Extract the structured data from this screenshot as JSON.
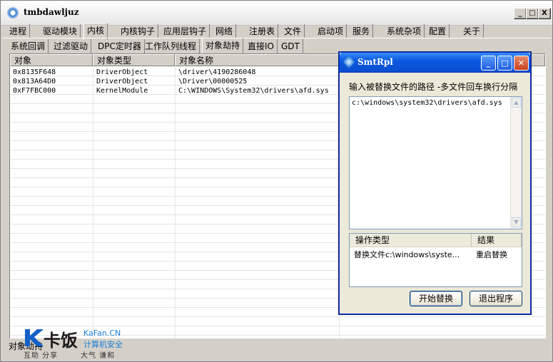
{
  "window": {
    "title": "tmbdawljuz",
    "min": "_",
    "max": "□",
    "close": "X"
  },
  "tabs_main": [
    {
      "label": "进程"
    },
    {
      "label": "驱动模块"
    },
    {
      "label": "内核"
    },
    {
      "label": "内核钩子"
    },
    {
      "label": "应用层钩子"
    },
    {
      "label": "网络"
    },
    {
      "label": "注册表"
    },
    {
      "label": "文件"
    },
    {
      "label": "启动项"
    },
    {
      "label": "服务"
    },
    {
      "label": "系统杂项"
    },
    {
      "label": "配置"
    },
    {
      "label": "关于"
    }
  ],
  "active_main_tab": "内核",
  "tabs_sub": [
    {
      "label": "系统回调"
    },
    {
      "label": "过滤驱动"
    },
    {
      "label": "DPC定时器"
    },
    {
      "label": "工作队列线程"
    },
    {
      "label": "对象劫持"
    },
    {
      "label": "直接IO"
    },
    {
      "label": "GDT"
    }
  ],
  "active_sub_tab": "对象劫持",
  "table": {
    "headers": [
      "对象",
      "对象类型",
      "对象名称"
    ],
    "rows": [
      [
        "0x8135F648",
        "DriverObject",
        "\\driver\\4190286048"
      ],
      [
        "0x813A64D0",
        "DriverObject",
        "\\Driver\\00000525"
      ],
      [
        "0xF7FBC000",
        "KernelModule",
        "C:\\WINDOWS\\System32\\drivers\\afd.sys"
      ]
    ]
  },
  "status": {
    "text": "对象劫持"
  },
  "dialog": {
    "title": "SmtRpl",
    "instruction": "输入被替换文件的路径 -多文件回车换行分隔",
    "path_value": "c:\\windows\\system32\\drivers\\afd.sys",
    "result_headers": [
      "操作类型",
      "结果"
    ],
    "result_row": [
      "替换文件c:\\windows\\syste...",
      "重启替换"
    ],
    "start_button": "开始替换",
    "exit_button": "退出程序",
    "scroll_up": "▲",
    "scroll_down": "▼"
  },
  "watermark": {
    "brand": "卡饭",
    "site": "KaFan.CN",
    "tag": "计算机安全",
    "slogan1": "互助 分享",
    "slogan2": "大气 谦和"
  }
}
